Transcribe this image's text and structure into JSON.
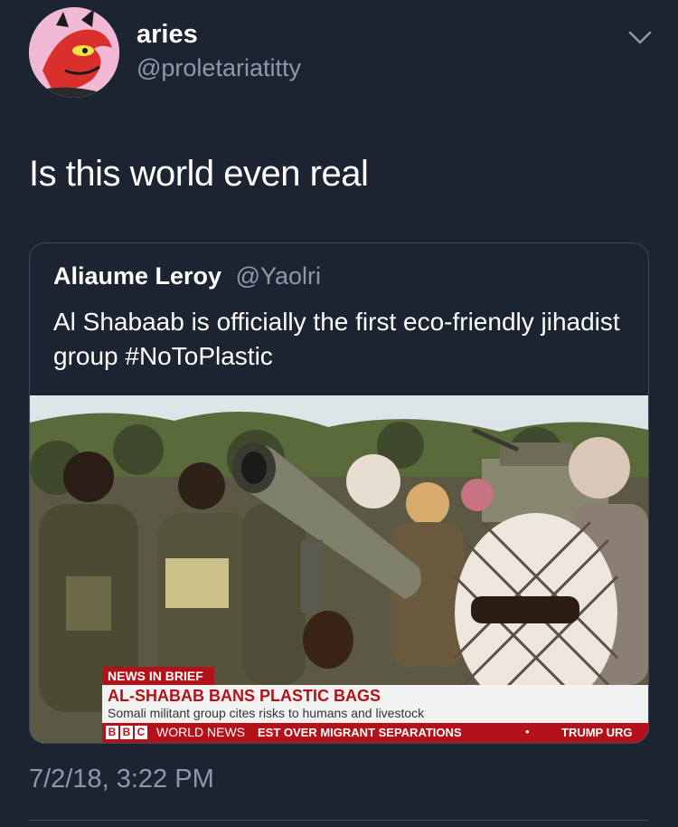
{
  "user": {
    "display_name": "aries",
    "handle": "@proletariatitty"
  },
  "tweet": {
    "text": "Is this world even real",
    "timestamp": "7/2/18, 3:22 PM"
  },
  "quoted_tweet": {
    "name": "Aliaume Leroy",
    "handle": "@Yaolri",
    "text": "Al Shabaab is officially the first eco-friendly jihadist group #NoToPlastic"
  },
  "news_graphic": {
    "tag": "NEWS IN BRIEF",
    "headline": "AL-SHABAB BANS PLASTIC BAGS",
    "subline": "Somali militant group cites risks to humans and livestock",
    "brand_letters": [
      "B",
      "B",
      "C"
    ],
    "channel": "WORLD NEWS",
    "ticker_text": "EST OVER MIGRANT SEPARATIONS",
    "ticker_text_2": "TRUMP URG",
    "bullet": "•"
  },
  "icons": {
    "menu": "chevron-down-icon",
    "avatar": "avatar"
  },
  "colors": {
    "background": "#1b2430",
    "secondary_text": "#8c99a6",
    "border": "#3d4957",
    "news_red": "#b3121a"
  }
}
